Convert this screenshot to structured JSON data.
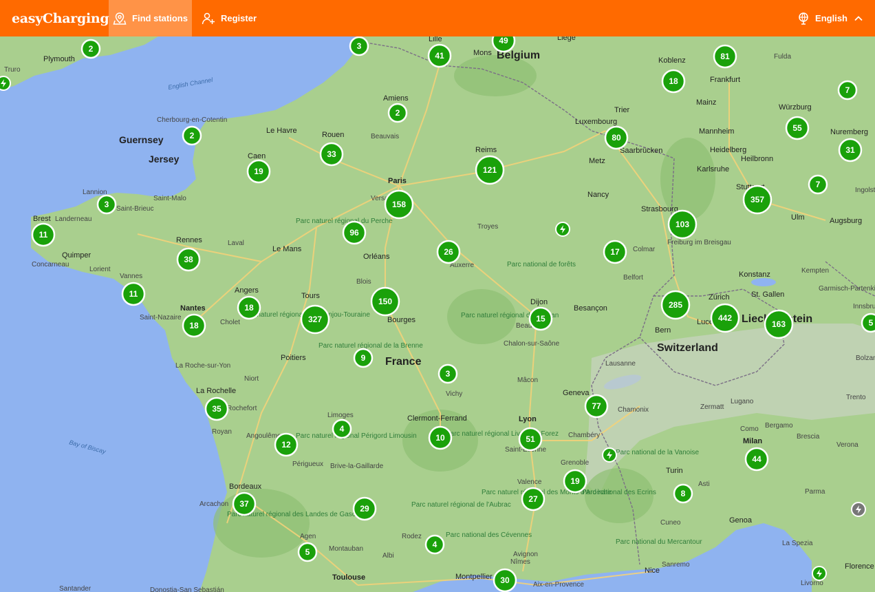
{
  "header": {
    "brand": "easyCharging",
    "find_stations": "Find stations",
    "register": "Register",
    "language": "English"
  },
  "colors": {
    "brand_orange": "#ff6a00",
    "cluster_green": "#1aa10a",
    "sea": "#8fb3f0",
    "land": "#a9cf8e"
  },
  "icons": {
    "find_stations": "map-pin-icon",
    "register": "add-user-icon",
    "language": "globe-icon",
    "chevron": "chevron-up-icon",
    "single_station": "lightning-bolt-icon"
  },
  "map": {
    "countries": [
      {
        "name": "Belgium"
      },
      {
        "name": "France"
      },
      {
        "name": "Switzerland"
      },
      {
        "name": "Liechtenstein"
      }
    ],
    "cities": [
      "Plymouth",
      "Truro",
      "Guernsey",
      "Jersey",
      "Cherbourg-en-Cotentin",
      "Le Havre",
      "Rouen",
      "Amiens",
      "Lille",
      "Mons",
      "Liège",
      "Koblenz",
      "Frankfurt",
      "Fulda",
      "Mainz",
      "Würzburg",
      "Trier",
      "Luxembourg",
      "Mannheim",
      "Nuremberg",
      "Saarbrücken",
      "Heidelberg",
      "Heilbronn",
      "Karlsruhe",
      "Reims",
      "Metz",
      "Nancy",
      "Caen",
      "Beauvais",
      "Paris",
      "Versailles",
      "Lannion",
      "Saint-Brieuc",
      "Saint-Malo",
      "Brest",
      "Landerneau",
      "Rennes",
      "Laval",
      "Le Mans",
      "Quimper",
      "Concarneau",
      "Lorient",
      "Vannes",
      "Strasbourg",
      "Freiburg im Breisgau",
      "Colmar",
      "Troyes",
      "Orléans",
      "Auxerre",
      "Stuttgart",
      "Ulm",
      "Augsburg",
      "Ingolstadt",
      "Konstanz",
      "Kempten",
      "Garmisch-Partenkirchen",
      "St. Gallen",
      "Zürich",
      "Lucerne",
      "Bern",
      "Innsbruck",
      "Bolzano",
      "Trento",
      "Blois",
      "Angers",
      "Tours",
      "Nantes",
      "Saint-Nazaire",
      "Cholet",
      "Bourges",
      "Dijon",
      "Besançon",
      "Belfort",
      "Beaune",
      "Chalon-sur-Saône",
      "La Roche-sur-Yon",
      "Poitiers",
      "Niort",
      "La Rochelle",
      "Rochefort",
      "Royan",
      "Angoulême",
      "Limoges",
      "Vichy",
      "Mâcon",
      "Lausanne",
      "Geneva",
      "Chamonix",
      "Zermatt",
      "Lugano",
      "Como",
      "Bergamo",
      "Brescia",
      "Verona",
      "Milan",
      "Clermont-Ferrand",
      "Lyon",
      "Saint-Etienne",
      "Chambéry",
      "Grenoble",
      "Périgueux",
      "Brive-la-Gaillarde",
      "Bordeaux",
      "Arcachon",
      "Valence",
      "Turin",
      "Asti",
      "Parma",
      "Cuneo",
      "Genoa",
      "La Spezia",
      "Agen",
      "Montauban",
      "Rodez",
      "Albi",
      "Nîmes",
      "Avignon",
      "Nice",
      "Sanremo",
      "Florence",
      "Livorno",
      "Toulouse",
      "Montpellier",
      "Aix-en-Provence",
      "Santander",
      "Donostia-San Sebastián"
    ],
    "parks": [
      "Parc naturel régional du Perche",
      "Parc national de forêts",
      "Parc naturel régional Loire-Anjou-Touraine",
      "Parc naturel régional du Morvan",
      "Parc naturel régional de la Brenne",
      "Parc naturel régional Périgord Limousin",
      "Parc naturel régional Livradois-Forez",
      "Parc national de la Vanoise",
      "Parc naturel régional des Landes de Gascogne",
      "Parc naturel régional de l'Aubrac",
      "Parc naturel régional des Monts d'Ardèche",
      "Parc national des Ecrins",
      "Parc national des Cévennes",
      "Parc national du Mercantour"
    ],
    "water": [
      "English Channel",
      "Bay of Biscay"
    ],
    "clusters": [
      {
        "count": "2"
      },
      {
        "count": "3"
      },
      {
        "count": "49"
      },
      {
        "count": "41"
      },
      {
        "count": "81"
      },
      {
        "count": "18"
      },
      {
        "count": "7"
      },
      {
        "count": "2"
      },
      {
        "count": "55"
      },
      {
        "count": "2"
      },
      {
        "count": "80"
      },
      {
        "count": "31"
      },
      {
        "count": "19"
      },
      {
        "count": "33"
      },
      {
        "count": "121"
      },
      {
        "count": "7"
      },
      {
        "count": "3"
      },
      {
        "count": "158"
      },
      {
        "count": "357"
      },
      {
        "count": "11"
      },
      {
        "count": "96"
      },
      {
        "count": "103"
      },
      {
        "count": "26"
      },
      {
        "count": "17"
      },
      {
        "count": "38"
      },
      {
        "count": "11"
      },
      {
        "count": "150"
      },
      {
        "count": "285"
      },
      {
        "count": "18"
      },
      {
        "count": "327"
      },
      {
        "count": "15"
      },
      {
        "count": "442"
      },
      {
        "count": "163"
      },
      {
        "count": "18"
      },
      {
        "count": "9"
      },
      {
        "count": "3"
      },
      {
        "count": "77"
      },
      {
        "count": "35"
      },
      {
        "count": "4"
      },
      {
        "count": "12"
      },
      {
        "count": "10"
      },
      {
        "count": "51"
      },
      {
        "count": "44"
      },
      {
        "count": "19"
      },
      {
        "count": "8"
      },
      {
        "count": "27"
      },
      {
        "count": "37"
      },
      {
        "count": "29"
      },
      {
        "count": "5"
      },
      {
        "count": "4"
      },
      {
        "count": "30"
      },
      {
        "count": "5"
      }
    ]
  }
}
